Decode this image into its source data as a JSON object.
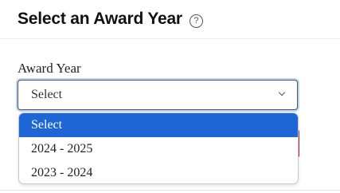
{
  "header": {
    "title": "Select an Award Year",
    "help_icon_glyph": "?",
    "help_icon_name": "help-circle-icon"
  },
  "form": {
    "label": "Award Year",
    "select_value": "Select",
    "options": [
      "Select",
      "2024 - 2025",
      "2023 - 2024"
    ],
    "selected_index": 0
  },
  "colors": {
    "highlight": "#1e65d6",
    "focus_ring": "#b9d4f3",
    "behind_button": "#c0283b"
  }
}
